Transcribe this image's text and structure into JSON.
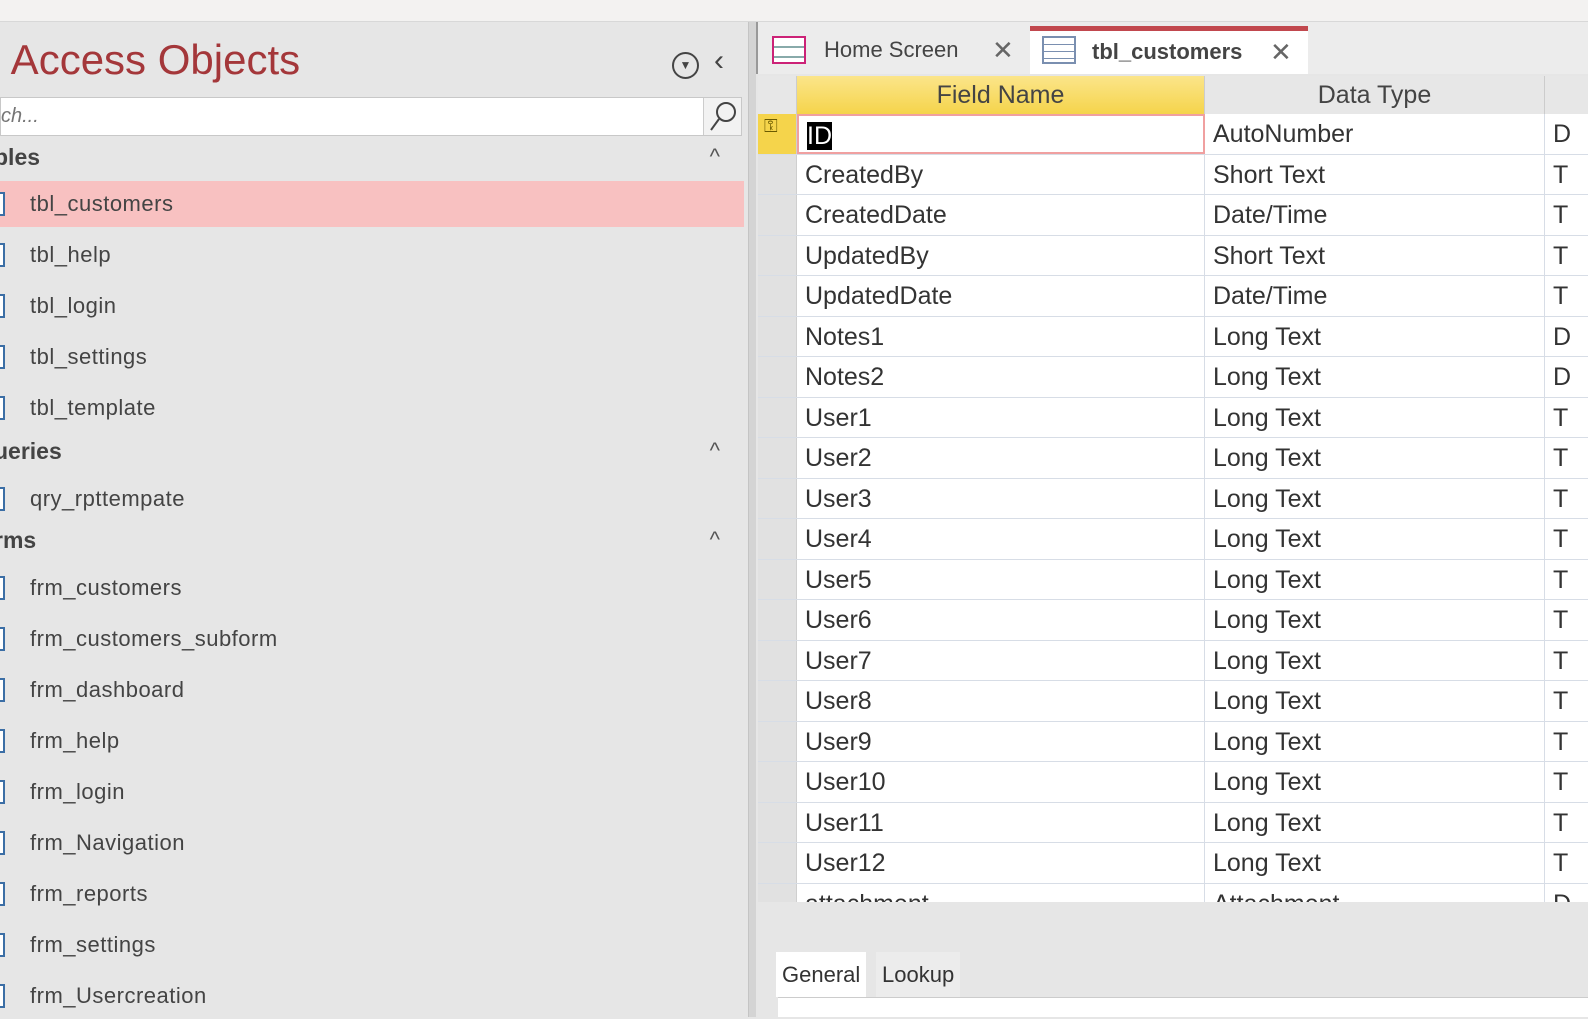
{
  "nav": {
    "title": "l Access Objects",
    "search_placeholder": "ch...",
    "sections": [
      {
        "label": "bles",
        "items": [
          "tbl_customers",
          "tbl_help",
          "tbl_login",
          "tbl_settings",
          "tbl_template"
        ]
      },
      {
        "label": "ueries",
        "items": [
          "qry_rpttempate"
        ]
      },
      {
        "label": "rms",
        "items": [
          "frm_customers",
          "frm_customers_subform",
          "frm_dashboard",
          "frm_help",
          "frm_login",
          "frm_Navigation",
          "frm_reports",
          "frm_settings",
          "frm_Usercreation"
        ]
      }
    ]
  },
  "tabs": [
    {
      "label": "Home Screen"
    },
    {
      "label": "tbl_customers"
    }
  ],
  "grid": {
    "headers": [
      "Field Name",
      "Data Type"
    ],
    "rows": [
      [
        "ID",
        "AutoNumber",
        "D"
      ],
      [
        "CreatedBy",
        "Short Text",
        "T"
      ],
      [
        "CreatedDate",
        "Date/Time",
        "T"
      ],
      [
        "UpdatedBy",
        "Short Text",
        "T"
      ],
      [
        "UpdatedDate",
        "Date/Time",
        "T"
      ],
      [
        "Notes1",
        "Long Text",
        "D"
      ],
      [
        "Notes2",
        "Long Text",
        "D"
      ],
      [
        "User1",
        "Long Text",
        "T"
      ],
      [
        "User2",
        "Long Text",
        "T"
      ],
      [
        "User3",
        "Long Text",
        "T"
      ],
      [
        "User4",
        "Long Text",
        "T"
      ],
      [
        "User5",
        "Long Text",
        "T"
      ],
      [
        "User6",
        "Long Text",
        "T"
      ],
      [
        "User7",
        "Long Text",
        "T"
      ],
      [
        "User8",
        "Long Text",
        "T"
      ],
      [
        "User9",
        "Long Text",
        "T"
      ],
      [
        "User10",
        "Long Text",
        "T"
      ],
      [
        "User11",
        "Long Text",
        "T"
      ],
      [
        "User12",
        "Long Text",
        "T"
      ],
      [
        "attachment",
        "Attachment",
        "D"
      ]
    ]
  },
  "property_tabs": [
    "General",
    "Lookup"
  ],
  "colors": {
    "accent": "#a4373a",
    "selected_row": "#f8c1c1",
    "header_active": "#f5d44b"
  }
}
